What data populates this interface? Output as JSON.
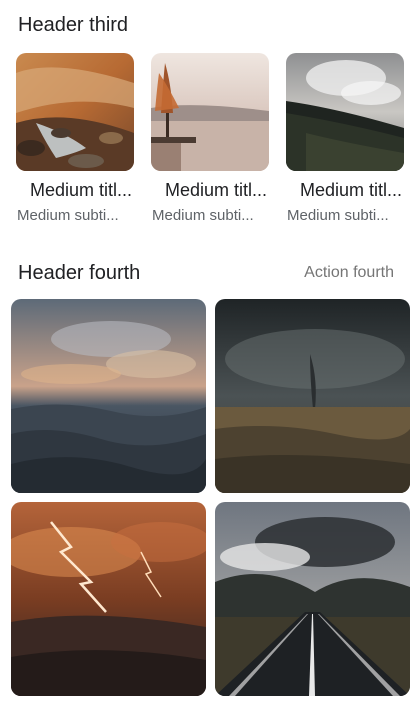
{
  "section_third": {
    "header": "Header third",
    "cards": [
      {
        "title": "Medium titl...",
        "subtitle": "Medium subti...",
        "image": "rocky-stream-autumn"
      },
      {
        "title": "Medium titl...",
        "subtitle": "Medium subti...",
        "image": "lake-tree-pier"
      },
      {
        "title": "Medium titl...",
        "subtitle": "Medium subti...",
        "image": "hillside-clouds"
      }
    ]
  },
  "section_fourth": {
    "header": "Header fourth",
    "action": "Action fourth",
    "tiles": [
      {
        "image": "ocean-sunset-waves"
      },
      {
        "image": "tornado-field"
      },
      {
        "image": "orange-lightning-sky"
      },
      {
        "image": "mountain-road"
      }
    ]
  }
}
